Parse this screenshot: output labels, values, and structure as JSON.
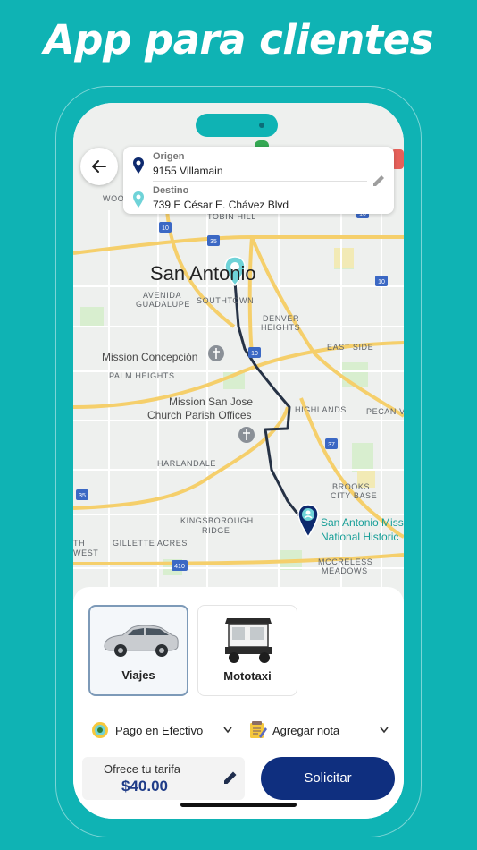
{
  "promo": {
    "title": "App para clientes"
  },
  "route": {
    "origin_label": "Origen",
    "origin_value": "9155 Villamain",
    "destination_label": "Destino",
    "destination_value": "739 E César E. Chávez Blvd"
  },
  "map": {
    "city": "San Antonio",
    "areas": {
      "woo": "WOO",
      "tobin_hill": "TOBIN HILL",
      "avenida_guadalupe_1": "AVENIDA",
      "avenida_guadalupe_2": "GUADALUPE",
      "southtown": "SOUTHTOWN",
      "denver_heights_1": "DENVER",
      "denver_heights_2": "HEIGHTS",
      "east_side": "EAST SIDE",
      "palm_heights": "PALM HEIGHTS",
      "highlands": "HIGHLANDS",
      "pecan_valley": "PECAN V",
      "harlandale": "HARLANDALE",
      "brooks_city_base_1": "BROOKS",
      "brooks_city_base_2": "CITY BASE",
      "kingsborough_ridge_1": "KINGSBOROUGH",
      "kingsborough_ridge_2": "RIDGE",
      "gillette_acres": "GILLETTE ACRES",
      "west_1": "TH",
      "west_2": "WEST",
      "mccreless_meadows_1": "MCCRELESS",
      "mccreless_meadows_2": "MEADOWS"
    },
    "pois": {
      "mission_concepcion": "Mission Concepción",
      "mission_san_jose_1": "Mission San Jose",
      "mission_san_jose_2": "Church Parish Offices",
      "san_antonio_missions_1": "San Antonio Miss",
      "san_antonio_missions_2": "National Historic"
    },
    "shields": [
      "10",
      "35",
      "10",
      "10",
      "35",
      "37",
      "35",
      "410",
      "10"
    ],
    "colors": {
      "route": "#263245",
      "origin_pin": "#6fd3d8",
      "destination_pin": "#0e2a6e"
    }
  },
  "vehicles": [
    {
      "name": "Viajes",
      "selected": true
    },
    {
      "name": "Mototaxi",
      "selected": false
    }
  ],
  "payment": {
    "label": "Pago en Efectivo"
  },
  "note": {
    "label": "Agregar nota"
  },
  "fare": {
    "label": "Ofrece tu tarifa",
    "value": "$40.00"
  },
  "actions": {
    "request_label": "Solicitar"
  },
  "theme": {
    "background": "#0fb3b4",
    "primary": "#0f2f7f",
    "fare_text": "#1f3c88"
  }
}
